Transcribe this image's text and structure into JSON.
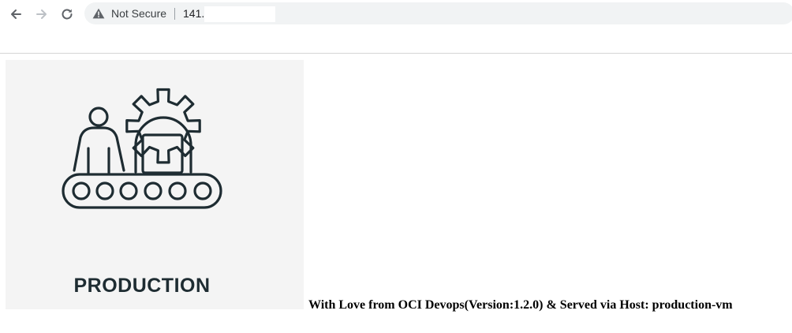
{
  "browser": {
    "security_label": "Not Secure",
    "url": "141.",
    "nav_icons": [
      "back-arrow-icon",
      "forward-arrow-icon",
      "reload-icon"
    ],
    "warning_icon": "warning-triangle-icon"
  },
  "page": {
    "image": {
      "label": "PRODUCTION",
      "icon": "production-conveyor-icon",
      "background": "#f4f4f4",
      "line_color": "#1e2c32"
    },
    "message": "With Love from OCI Devops(Version:1.2.0) & Served via Host: production-vm"
  }
}
